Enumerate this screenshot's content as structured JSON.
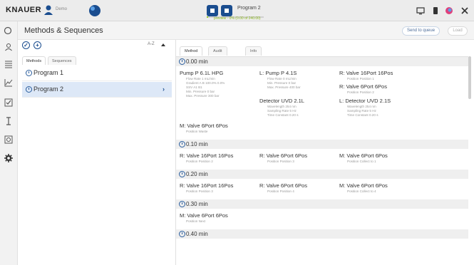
{
  "app": {
    "brand": "KNAUER",
    "brand_sub": "Demo",
    "program_name": "Program 2",
    "progress_text": "preview · 0% (0.00 of 240.00)",
    "progress_fraction": 0.0
  },
  "colors": {
    "accent": "#1a4d8f",
    "progress": "#9ccf2d",
    "selection": "#dde8f7"
  },
  "header": {
    "title": "Methods & Sequences",
    "send_to_queue": "Send to queue",
    "load": "Load"
  },
  "list": {
    "sort_label": "A-Z",
    "tabs": [
      "Methods",
      "Sequences"
    ],
    "items": [
      {
        "label": "Program 1",
        "selected": false
      },
      {
        "label": "Program 2",
        "selected": true
      }
    ]
  },
  "detail": {
    "tabs": [
      "Method",
      "Audit Trail",
      "Info"
    ],
    "steps": [
      {
        "time": "0.00 min",
        "devices": [
          {
            "name": "Pump P 6.1L HPG",
            "lines": [
              "Flow Rate 1 mL/min",
              "Gradient A B 100.0% 0.0%",
              "SSV A1 B1",
              "Min. Pressure 0 bar",
              "Max. Pressure 300 bar"
            ]
          },
          {
            "name": "L: Pump P 4.1S",
            "lines": [
              "Flow Rate 0 mL/min",
              "Min. Pressure 0 bar",
              "Max. Pressure 400 bar"
            ]
          },
          {
            "name": "R: Valve 16Port 16Pos",
            "lines": [
              "Position Position 1"
            ]
          },
          {
            "name": "R: Valve 6Port 6Pos",
            "lines": [
              "Position Position 2"
            ]
          },
          {
            "name": "Detector UVD 2.1L",
            "lines": [
              "Wavelength 254 nm",
              "Sampling Rate 5 Hz",
              "Time Constant 0.20 s"
            ]
          },
          {
            "name": "L: Detector UVD 2.1S",
            "lines": [
              "Wavelength 254 nm",
              "Sampling Rate 5 Hz",
              "Time Constant 0.20 s"
            ]
          },
          {
            "name": "M: Valve 6Port 6Pos",
            "lines": [
              "Position Waste"
            ]
          }
        ]
      },
      {
        "time": "0.10 min",
        "devices": [
          {
            "name": "R: Valve 16Port 16Pos",
            "lines": [
              "Position Position 2"
            ]
          },
          {
            "name": "R: Valve 6Port 6Pos",
            "lines": [
              "Position Position 3"
            ]
          },
          {
            "name": "M: Valve 6Port 6Pos",
            "lines": [
              "Position Collect to 1"
            ]
          }
        ]
      },
      {
        "time": "0.20 min",
        "devices": [
          {
            "name": "R: Valve 16Port 16Pos",
            "lines": [
              "Position Position 3"
            ]
          },
          {
            "name": "R: Valve 6Port 6Pos",
            "lines": [
              "Position Position 4"
            ]
          },
          {
            "name": "M: Valve 6Port 6Pos",
            "lines": [
              "Position Collect to 4"
            ]
          }
        ]
      },
      {
        "time": "0.30 min",
        "devices": [
          {
            "name": "M: Valve 6Port 6Pos",
            "lines": [
              "Position Next"
            ]
          }
        ]
      },
      {
        "time": "0.40 min",
        "devices": []
      }
    ]
  }
}
